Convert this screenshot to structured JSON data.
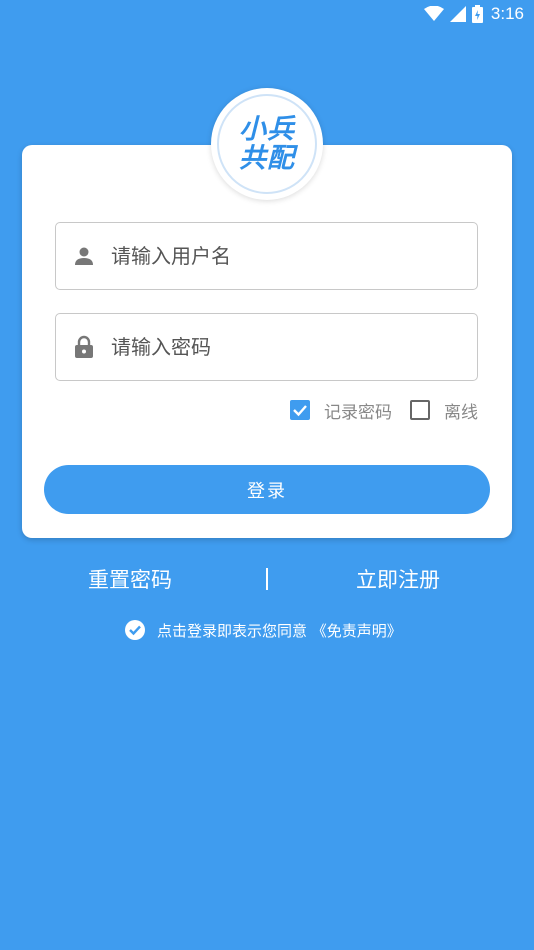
{
  "status_bar": {
    "time": "3:16",
    "icons": [
      "wifi-icon",
      "signal-icon",
      "battery-icon"
    ]
  },
  "logo": {
    "line1": "小兵",
    "line2": "共配"
  },
  "form": {
    "username_placeholder": "请输入用户名",
    "password_placeholder": "请输入密码",
    "remember_label": "记录密码",
    "remember_checked": true,
    "offline_label": "离线",
    "offline_checked": false,
    "login_label": "登录"
  },
  "links": {
    "reset": "重置密码",
    "register": "立即注册"
  },
  "agreement": {
    "text": "点击登录即表示您同意",
    "link": "《免责声明》"
  },
  "colors": {
    "accent": "#3f9cef",
    "card": "#ffffff"
  }
}
